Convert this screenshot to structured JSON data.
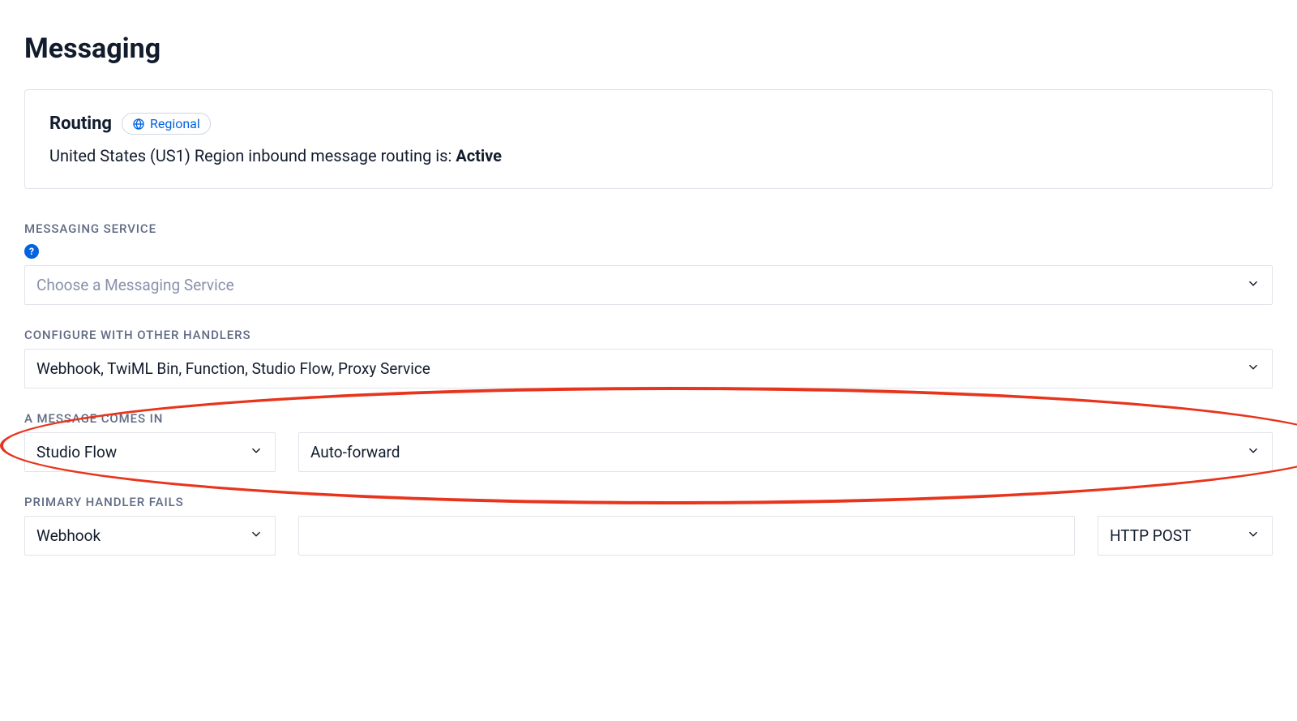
{
  "page": {
    "title": "Messaging"
  },
  "routing_card": {
    "title": "Routing",
    "pill_label": "Regional",
    "status_prefix": "United States (US1) Region inbound message routing is: ",
    "status_value": "Active"
  },
  "messaging_service": {
    "label": "MESSAGING SERVICE",
    "placeholder": "Choose a Messaging Service"
  },
  "other_handlers": {
    "label": "CONFIGURE WITH OTHER HANDLERS",
    "value": "Webhook, TwiML Bin, Function, Studio Flow, Proxy Service"
  },
  "message_comes_in": {
    "label": "A MESSAGE COMES IN",
    "handler_type": "Studio Flow",
    "handler_value": "Auto-forward"
  },
  "primary_handler_fails": {
    "label": "PRIMARY HANDLER FAILS",
    "handler_type": "Webhook",
    "url_value": "",
    "http_method": "HTTP POST"
  }
}
